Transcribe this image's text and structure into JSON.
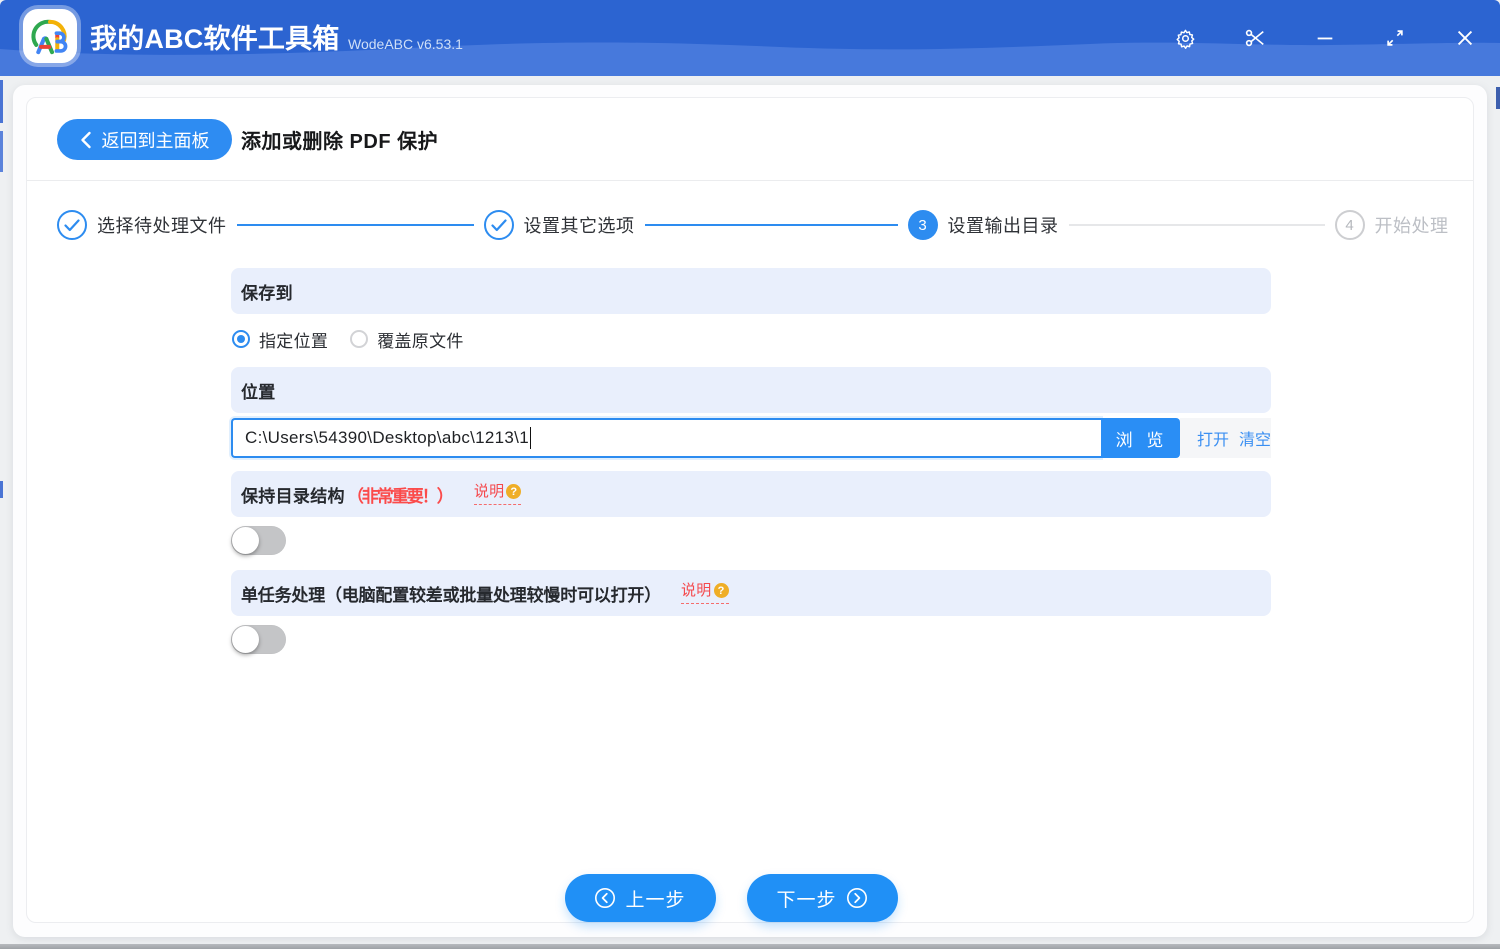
{
  "window": {
    "app_title": "我的ABC软件工具箱",
    "version": "WodeABC v6.53.1",
    "controls": {
      "settings": "settings",
      "screenshot": "scissors",
      "minimize": "minimize",
      "maximize": "maximize",
      "close": "close"
    }
  },
  "page": {
    "back_label": "返回到主面板",
    "title": "添加或删除 PDF 保护"
  },
  "steps": [
    {
      "label": "选择待处理文件",
      "state": "done"
    },
    {
      "label": "设置其它选项",
      "state": "done"
    },
    {
      "label": "设置输出目录",
      "state": "active",
      "number": "3"
    },
    {
      "label": "开始处理",
      "state": "pending",
      "number": "4"
    }
  ],
  "form": {
    "save_to": {
      "label": "保存到",
      "options": [
        {
          "label": "指定位置",
          "selected": true
        },
        {
          "label": "覆盖原文件",
          "selected": false
        }
      ]
    },
    "location": {
      "label": "位置",
      "value": "C:\\Users\\54390\\Desktop\\abc\\1213\\1",
      "browse_label": "浏 览",
      "open_label": "打开",
      "clear_label": "清空"
    },
    "keep_structure": {
      "label": "保持目录结构",
      "important": "（非常重要！）",
      "help_label": "说明",
      "enabled": false
    },
    "help_question_symbol": "?",
    "single_task": {
      "label": "单任务处理（电脑配置较差或批量处理较慢时可以打开）",
      "help_label": "说明",
      "enabled": false
    }
  },
  "footer": {
    "prev_label": "上一步",
    "next_label": "下一步"
  },
  "colors": {
    "titlebar": "#2c64d1",
    "titlebar_wave": "#4779dc",
    "primary": "#2d8cf0",
    "section_bar": "#e9effc",
    "red": "#fb4b4b",
    "help_red": "#f5494d",
    "question_orange": "#efae27",
    "link_blue": "#3a8ff2"
  }
}
